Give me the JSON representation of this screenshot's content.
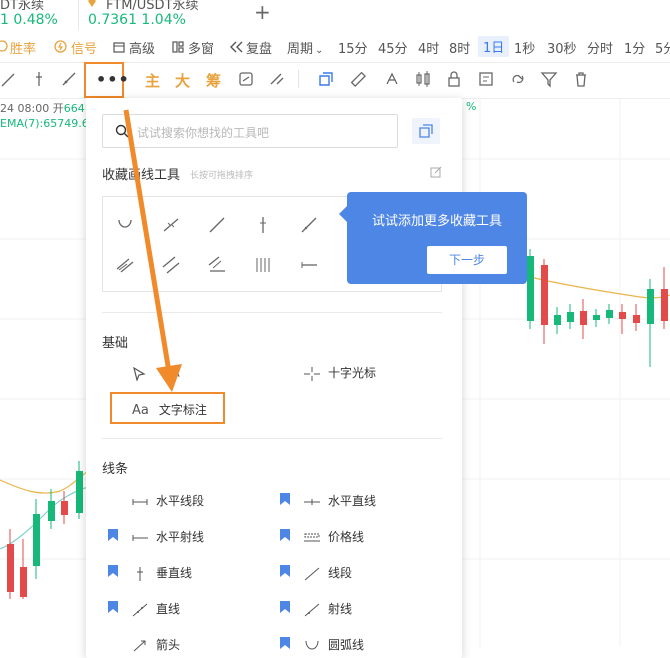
{
  "ticker": {
    "item1_name": "DT永续",
    "item1_price": "1  0.48%",
    "item2_name": "FTM/USDT永续",
    "item2_price": "0.7361  1.04%",
    "add_symbol": "+"
  },
  "toolbar1": {
    "winrate": "胜率",
    "signal": "信号",
    "advanced": "高级",
    "multi_chart": "多窗",
    "replay": "复盘",
    "period": "周期",
    "periods": [
      "15分",
      "45分",
      "4时",
      "8时",
      "1日",
      "1秒",
      "30秒",
      "分时",
      "1分",
      "5分"
    ],
    "active_period": "1日"
  },
  "toolbar2": {
    "more_label": "•••",
    "main_label": "主",
    "big_label": "大",
    "chip_label": "筹"
  },
  "chart_info": {
    "date_open": "24 08:00  开",
    "open_value": "664",
    "ema": "EMA(7):65749.6",
    "pct": "%"
  },
  "panel": {
    "search_placeholder": "试试搜索你想找的工具吧",
    "favorites_title": "收藏画线工具",
    "favorites_hint": "长按可拖拽排序",
    "basic_title": "基础",
    "cursor_label": "标",
    "crosshair_label": "十字光标",
    "text_annotation_label": "文字标注",
    "lines_title": "线条",
    "lines": [
      {
        "label": "水平线段"
      },
      {
        "label": "水平直线"
      },
      {
        "label": "水平射线"
      },
      {
        "label": "价格线"
      },
      {
        "label": "垂直线"
      },
      {
        "label": "线段"
      },
      {
        "label": "直线"
      },
      {
        "label": "射线"
      },
      {
        "label": "箭头"
      },
      {
        "label": "圆弧线"
      }
    ]
  },
  "tooltip": {
    "text": "试试添加更多收藏工具",
    "next_button": "下一步"
  },
  "colors": {
    "accent": "#4e86e6",
    "highlight": "#f08a2a",
    "up": "#16b979",
    "down": "#e34b4b",
    "ema_line": "#e8b54a"
  }
}
